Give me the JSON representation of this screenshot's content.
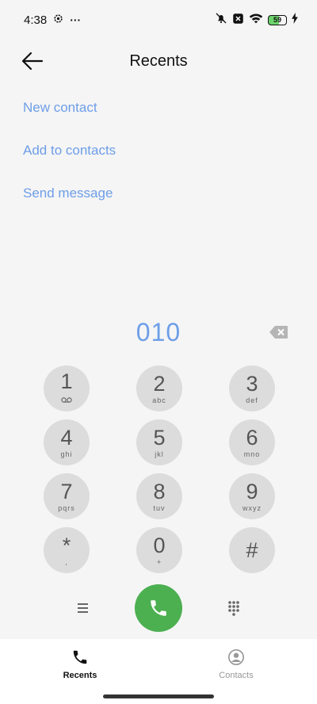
{
  "status": {
    "time": "4:38",
    "more": "···",
    "battery_level": "59",
    "icons": [
      "gear-icon",
      "bell-off-icon",
      "no-sim-icon",
      "wifi-icon",
      "battery-icon",
      "charging-icon"
    ]
  },
  "header": {
    "title": "Recents"
  },
  "menu": {
    "new_contact": "New contact",
    "add_to_contacts": "Add to contacts",
    "send_message": "Send message"
  },
  "dialer": {
    "number": "010",
    "keys": [
      {
        "digit": "1",
        "letters": ""
      },
      {
        "digit": "2",
        "letters": "abc"
      },
      {
        "digit": "3",
        "letters": "def"
      },
      {
        "digit": "4",
        "letters": "ghi"
      },
      {
        "digit": "5",
        "letters": "jkl"
      },
      {
        "digit": "6",
        "letters": "mno"
      },
      {
        "digit": "7",
        "letters": "pqrs"
      },
      {
        "digit": "8",
        "letters": "tuv"
      },
      {
        "digit": "9",
        "letters": "wxyz"
      },
      {
        "digit": "*",
        "letters": ","
      },
      {
        "digit": "0",
        "letters": "+"
      },
      {
        "digit": "#",
        "letters": ""
      }
    ]
  },
  "nav": {
    "recents": "Recents",
    "contacts": "Contacts"
  },
  "colors": {
    "accent": "#6d9ee8",
    "call": "#4caf50",
    "key_bg": "#dcdcdc"
  }
}
